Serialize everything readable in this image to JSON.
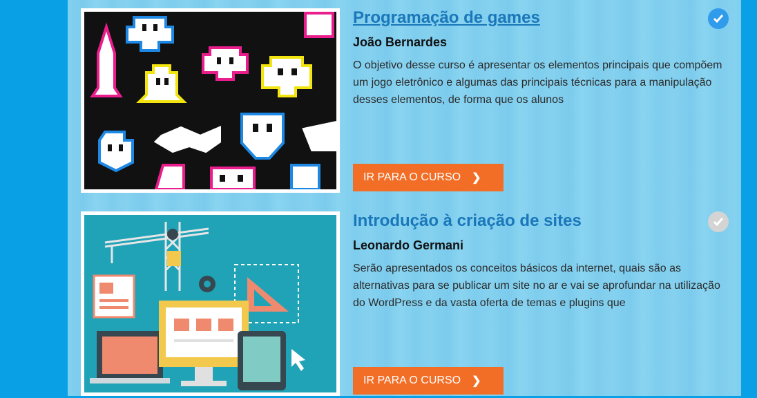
{
  "courses": [
    {
      "title": "Programação de games",
      "author": "João Bernardes",
      "description": "O objetivo desse curso é apresentar os elementos principais que compõem um jogo eletrônico e algumas das principais técnicas para a manipulação desses elementos, de forma que os alunos",
      "button_label": "IR PARA O CURSO",
      "completed": true,
      "check_color": "#2f9bea",
      "thumbnail_icon": "pixel-invaders-image"
    },
    {
      "title": "Introdução à criação de sites",
      "author": "Leonardo Germani",
      "description": "Serão apresentados os conceitos básicos da internet, quais são as alternativas para se publicar um site no ar e vai se aprofundar na utilização do WordPress e da vasta oferta de temas e plugins que",
      "button_label": "IR PARA O CURSO",
      "completed": false,
      "check_color": "#d4d4d4",
      "thumbnail_icon": "website-construction-image"
    }
  ],
  "colors": {
    "accent_button": "#f26e27",
    "title_link": "#1a77b9",
    "page_background": "#0aa0e6"
  }
}
